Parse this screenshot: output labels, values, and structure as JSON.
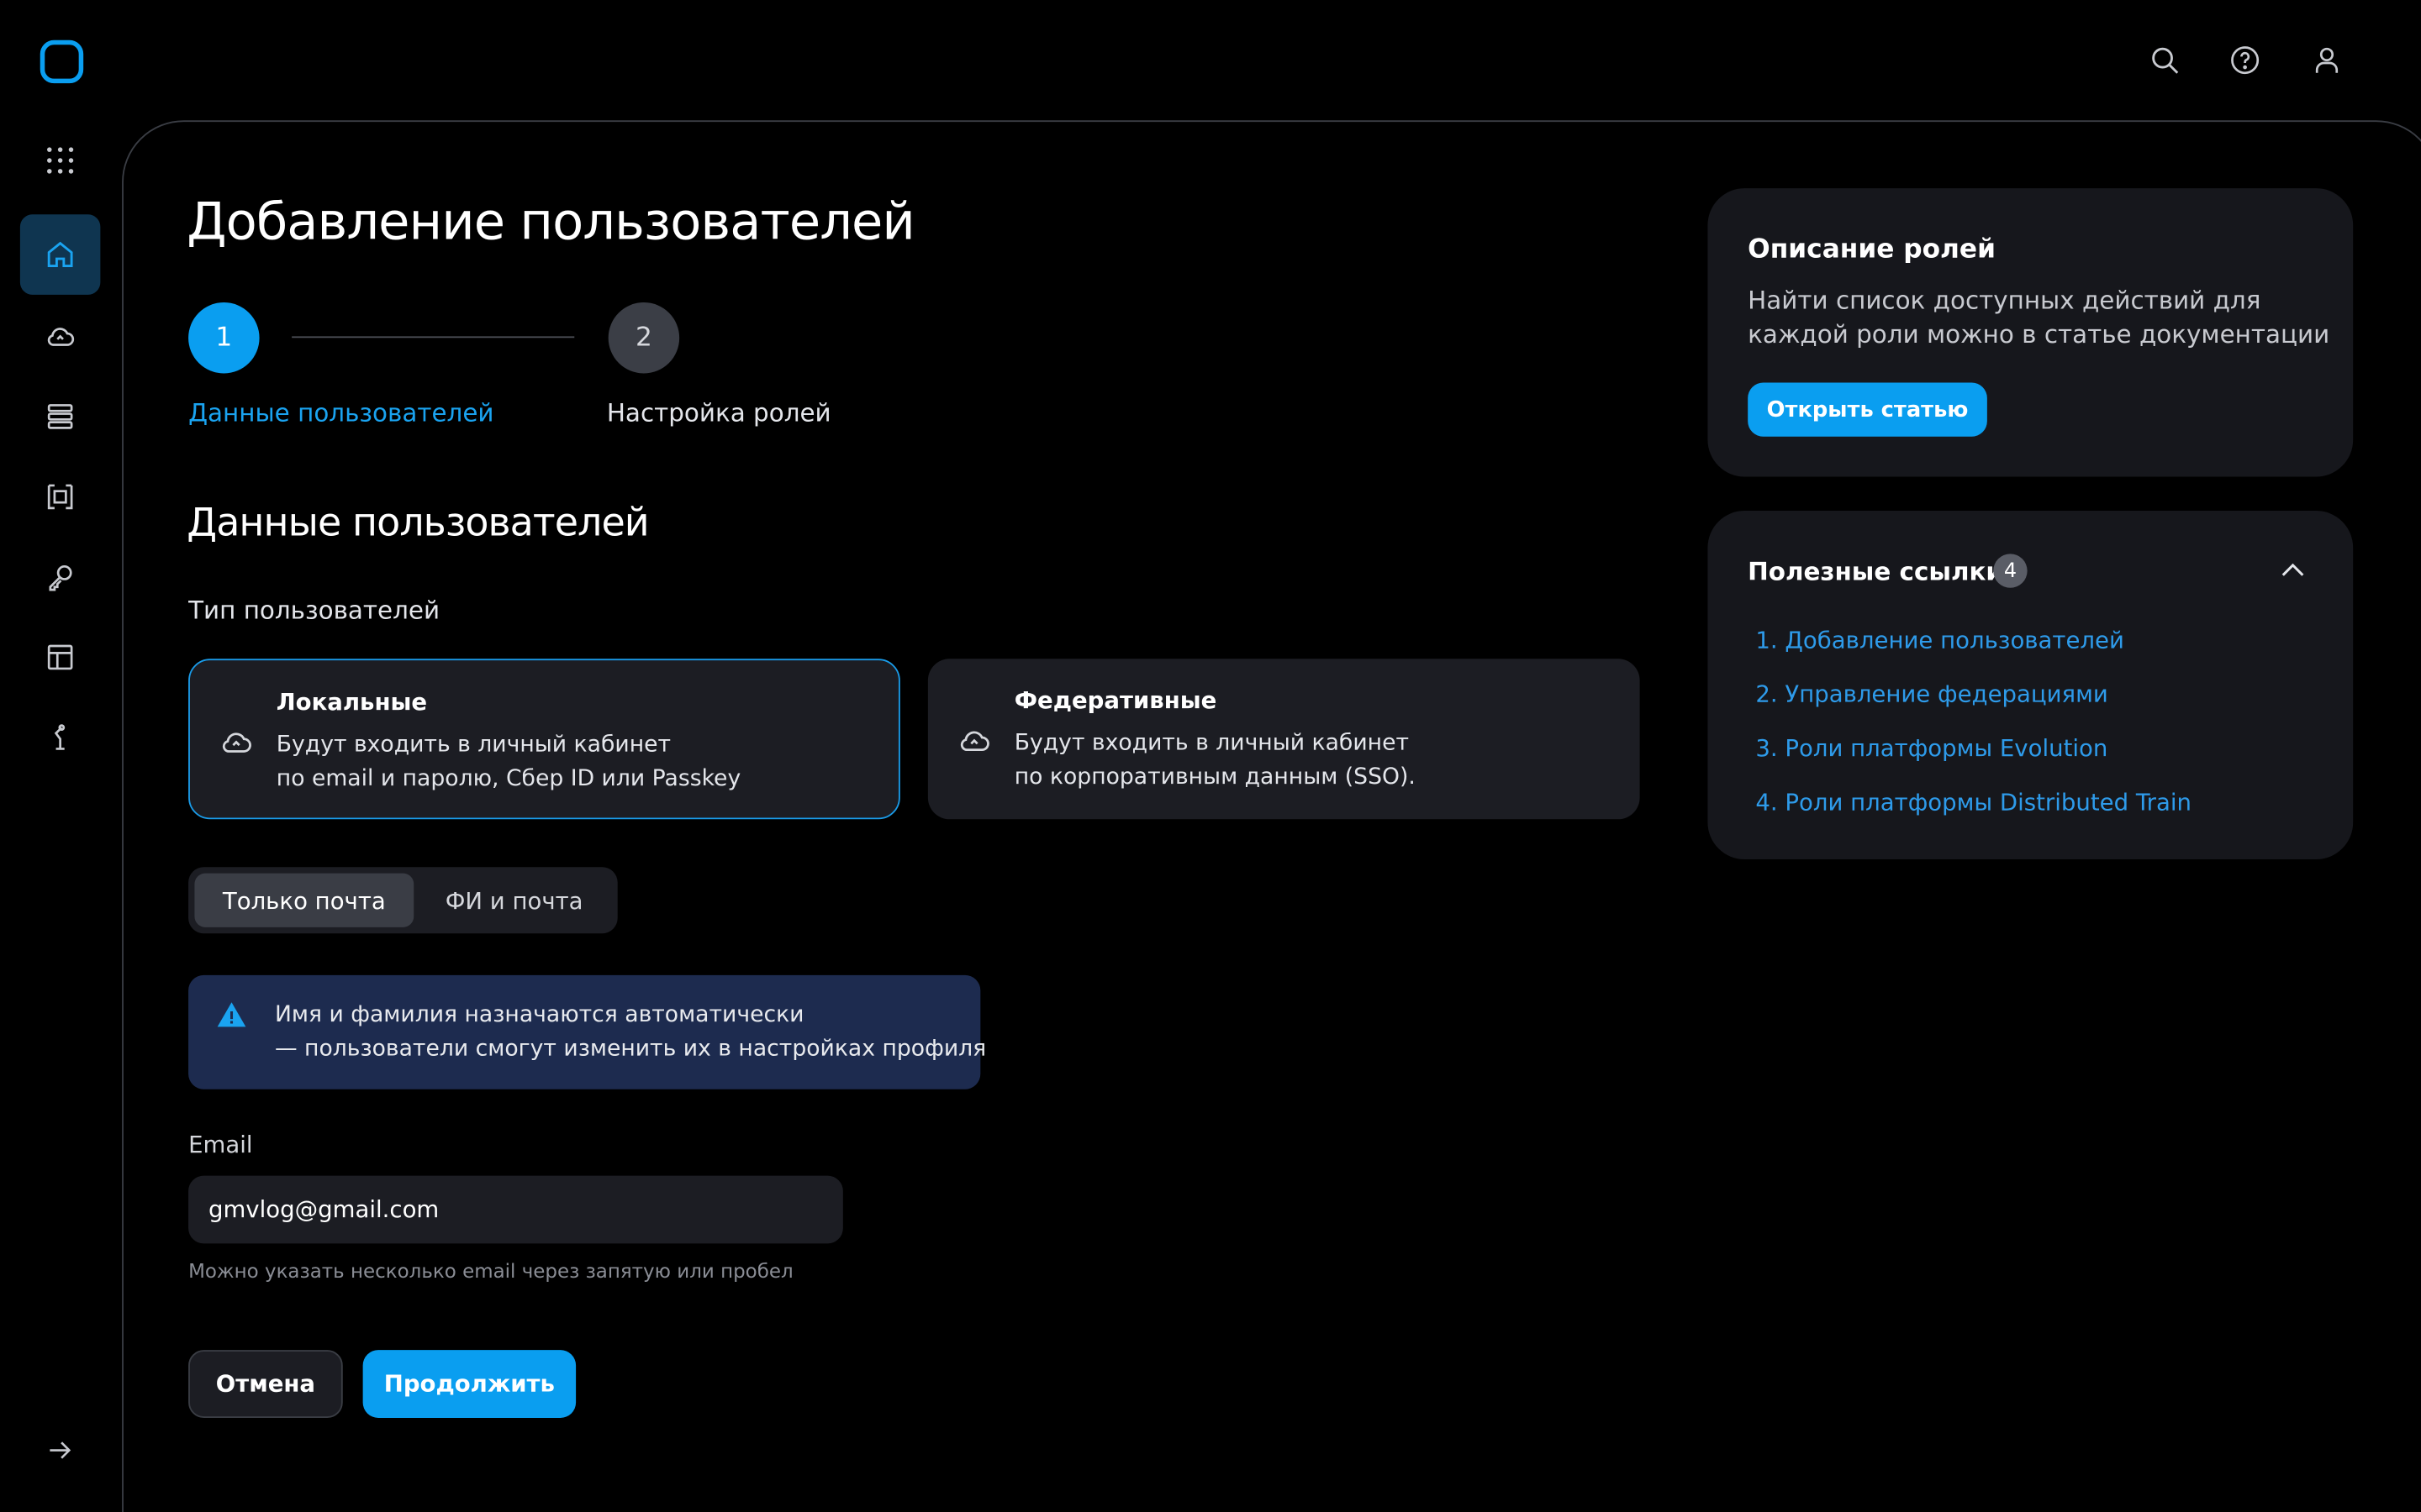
{
  "header": {
    "icons": [
      "search-icon",
      "help-icon",
      "user-icon"
    ]
  },
  "sidebar": {
    "items": [
      {
        "icon": "apps-grid-icon"
      },
      {
        "icon": "home-icon",
        "active": true
      },
      {
        "icon": "cloud-icon"
      },
      {
        "icon": "database-icon"
      },
      {
        "icon": "frame-icon"
      },
      {
        "icon": "key-icon"
      },
      {
        "icon": "layout-icon"
      },
      {
        "icon": "robot-arm-icon"
      },
      {
        "icon": "arrow-right-icon"
      }
    ]
  },
  "page": {
    "title": "Добавление пользователей"
  },
  "stepper": {
    "steps": [
      {
        "number": "1",
        "label": "Данные пользователей",
        "active": true
      },
      {
        "number": "2",
        "label": "Настройка ролей",
        "active": false
      }
    ]
  },
  "section": {
    "title": "Данные пользователей",
    "user_type_label": "Тип пользователей"
  },
  "user_types": [
    {
      "title": "Локальные",
      "desc_line1": "Будут входить в личный кабинет",
      "desc_line2": "по email и паролю, Сбер ID или Passkey",
      "selected": true
    },
    {
      "title": "Федеративные",
      "desc_line1": "Будут входить в личный кабинет",
      "desc_line2": "по корпоративным данным (SSO).",
      "selected": false
    }
  ],
  "segmented": {
    "options": [
      "Только почта",
      "ФИ и почта"
    ],
    "selected": "Только почта"
  },
  "alert": {
    "line1": "Имя и фамилия назначаются автоматически",
    "line2": "— пользователи смогут изменить их в настройках профиля"
  },
  "email": {
    "label": "Email",
    "value": "gmvlog@gmail.com",
    "hint": "Можно указать несколько email через запятую или пробел"
  },
  "actions": {
    "cancel": "Отмена",
    "continue": "Продолжить"
  },
  "roles_card": {
    "title": "Описание ролей",
    "text_line1": "Найти список доступных действий для",
    "text_line2": "каждой роли можно в статье документации",
    "button": "Открыть статью"
  },
  "links_card": {
    "title": "Полезные ссылки",
    "count": "4",
    "links": [
      "1. Добавление пользователей",
      "2. Управление федерациями",
      "3. Роли платформы Evolution",
      "4. Роли платформы Distributed Train"
    ]
  },
  "colors": {
    "accent": "#0a9ef0",
    "background": "#000000",
    "card": "#1c1d23",
    "link": "#2e9bea",
    "alert_bg": "#1d2b4f"
  }
}
